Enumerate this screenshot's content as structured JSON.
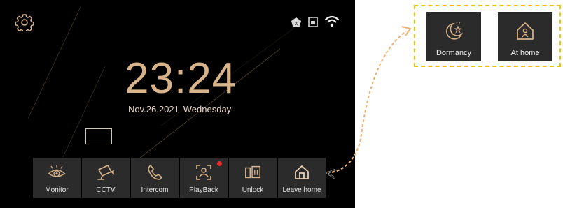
{
  "clock": {
    "time": "23:24",
    "date": "Nov.26.2021",
    "weekday": "Wednesday"
  },
  "icons": {
    "settings": "gear-icon",
    "status": [
      "away-status-icon",
      "sd-card-icon",
      "wifi-icon"
    ]
  },
  "dock": {
    "items": [
      {
        "label": "Monitor",
        "icon": "eye-icon"
      },
      {
        "label": "CCTV",
        "icon": "cctv-camera-icon"
      },
      {
        "label": "Intercom",
        "icon": "phone-icon"
      },
      {
        "label": "PlayBack",
        "icon": "playback-face-icon",
        "notification": true
      },
      {
        "label": "Unlock",
        "icon": "unlock-door-icon"
      },
      {
        "label": "Leave home",
        "icon": "house-icon"
      }
    ]
  },
  "scene_modes": {
    "items": [
      {
        "label": "Dormancy",
        "icon": "moon-star-icon"
      },
      {
        "label": "At home",
        "icon": "home-person-icon"
      }
    ]
  },
  "colors": {
    "accent": "#d9b48a",
    "tile": "#2b2b2b",
    "highlight_border": "#f2c200",
    "badge": "#e62a2a"
  }
}
